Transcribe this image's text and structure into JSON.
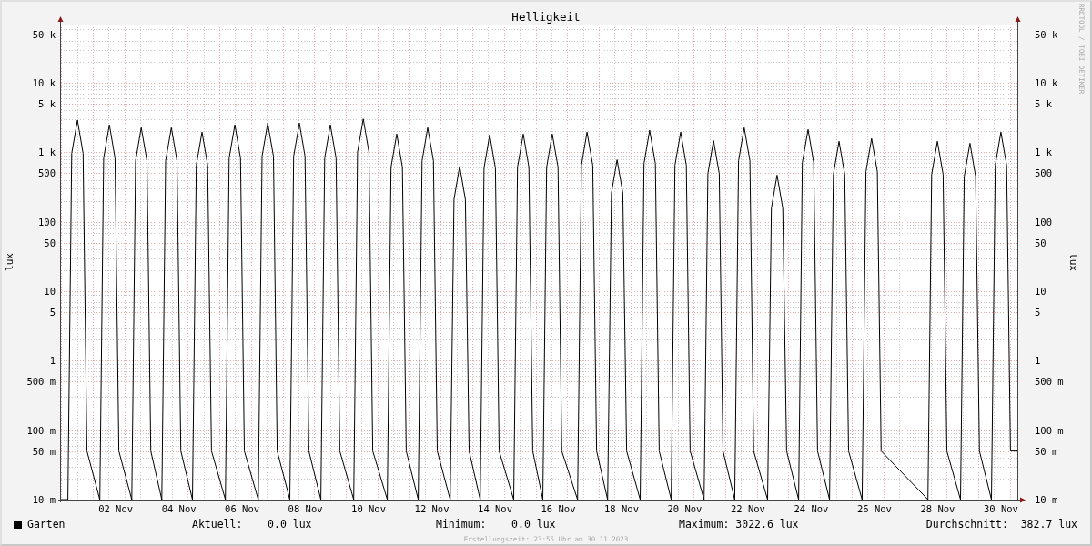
{
  "graph": {
    "title": "Helligkeit",
    "ylabel": "lux",
    "y2label": "lux",
    "y_tick_labels": [
      "50 k",
      "10 k",
      "5 k",
      "1 k",
      "500",
      "100",
      "50",
      "10",
      "5",
      "1",
      "500 m",
      "100 m",
      "50 m",
      "10 m"
    ],
    "y2_tick_labels": [
      "50 k",
      "10 k",
      "5 k",
      "1 k",
      "500",
      "100",
      "50",
      "10",
      "5",
      "1",
      "500 m",
      "100 m",
      "50 m",
      "10 m"
    ],
    "x_tick_labels": [
      "02 Nov",
      "04 Nov",
      "06 Nov",
      "08 Nov",
      "10 Nov",
      "12 Nov",
      "14 Nov",
      "16 Nov",
      "18 Nov",
      "20 Nov",
      "22 Nov",
      "24 Nov",
      "26 Nov",
      "28 Nov",
      "30 Nov"
    ],
    "legend": {
      "name": "Garten",
      "color": "#000000"
    },
    "stats": [
      {
        "label": "Aktuell:",
        "value": "0.0 lux"
      },
      {
        "label": "Minimum:",
        "value": "0.0 lux"
      },
      {
        "label": "Maximum:",
        "value": "3022.6 lux"
      },
      {
        "label": "Durchschnitt:",
        "value": "382.7 lux"
      }
    ],
    "footer": "Erstellungszeit: 23:55 Uhr am 30.11.2023",
    "credit": "RRDTOOL / TOBI OETIKER"
  }
}
